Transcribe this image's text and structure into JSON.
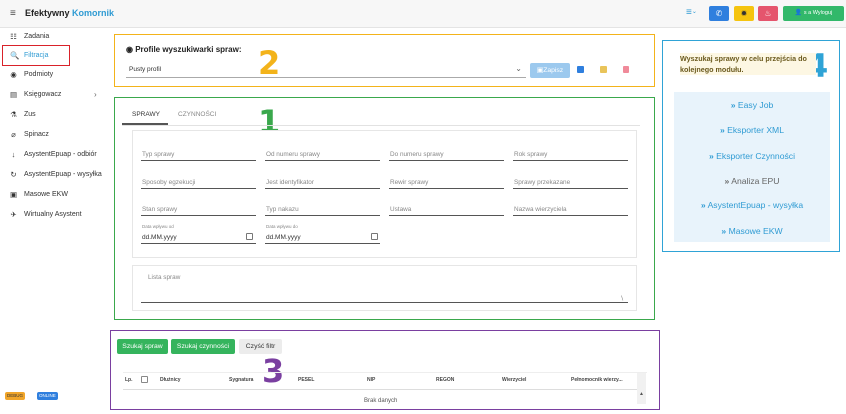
{
  "app": {
    "brand_primary": "Efektywny",
    "brand_secondary": "Komornik",
    "hamburger": "≡"
  },
  "toolbar": {
    "list_icon": "≡",
    "list_chevron": "⌄",
    "phone_icon": "✆",
    "gear_icon": "✹",
    "fire_icon": "♨",
    "user_icon": "👤",
    "user_label": "s a",
    "logout_label": "Wyloguj",
    "colors": {
      "list": "#2f9bd3",
      "phone": "#2f7fde",
      "gear": "#f5c40f",
      "fire": "#e5556d",
      "user": "#32b86a"
    }
  },
  "sidebar": {
    "items": [
      {
        "label": "Zadania",
        "icon": "☷",
        "icon_name": "tasks-list-icon"
      },
      {
        "label": "Filtracja",
        "icon": "🔍",
        "icon_name": "search-icon"
      },
      {
        "label": "Podmioty",
        "icon": "◉",
        "icon_name": "globe-icon"
      },
      {
        "label": "Księgowacz",
        "icon": "▤",
        "icon_name": "accounting-icon",
        "chevron": "›"
      },
      {
        "label": "Zus",
        "icon": "⚗",
        "icon_name": "zus-icon"
      },
      {
        "label": "Spinacz",
        "icon": "⌀",
        "icon_name": "paperclip-icon"
      },
      {
        "label": "AsystentEpuap - odbiór",
        "icon": "↓",
        "icon_name": "download-icon"
      },
      {
        "label": "AsystentEpuap - wysyłka",
        "icon": "↻",
        "icon_name": "send-icon"
      },
      {
        "label": "Masowe EKW",
        "icon": "▣",
        "icon_name": "database-icon"
      },
      {
        "label": "Wirtualny Asystent",
        "icon": "✈",
        "icon_name": "rocket-icon"
      }
    ]
  },
  "badges": {
    "debug": "DEBUG",
    "online": "ONLINE"
  },
  "annotations": {
    "n1": "1",
    "n2": "2",
    "n3": "3",
    "n4": "4"
  },
  "profiles": {
    "title": "Profile wyszukiwarki spraw:",
    "select_value": "Pusty profil",
    "save_label": "Zapisz"
  },
  "tabs": {
    "sprawy": "SPRAWY",
    "czynnosci": "CZYNNOŚCI"
  },
  "filters": {
    "typ_sprawy": "Typ sprawy",
    "od_numeru": "Od numeru sprawy",
    "do_numeru": "Do numeru sprawy",
    "rok": "Rok sprawy",
    "sposoby": "Sposoby egzekucji",
    "jest_id": "Jest identyfikator",
    "rewir": "Rewir sprawy",
    "przekazane": "Sprawy przekazane",
    "stan": "Stan sprawy",
    "typ_nakazu": "Typ nakazu",
    "ustawa": "Ustawa",
    "nazwa_wierzyciela": "Nazwa wierzyciela",
    "data_od_label": "Data wpływu od",
    "data_od_value": "dd.MM.yyyy",
    "data_do_label": "Data wpływu do",
    "data_do_value": "dd.MM.yyyy",
    "lista_spraw": "Lista spraw"
  },
  "right_panel": {
    "heading": "Wyszukaj sprawy w celu przejścia do kolejnego modułu.",
    "links": [
      "Easy Job",
      "Eksporter XML",
      "Eksporter Czynności",
      "Analiza EPU",
      "AsystentEpuap - wysyłka",
      "Masowe EKW"
    ],
    "arrow": "»"
  },
  "actions": {
    "szukaj_spraw": "Szukaj spraw",
    "szukaj_czynnosci": "Szukaj czynności",
    "czysc": "Czyść filtr"
  },
  "table": {
    "columns": [
      "Lp.",
      "Dłużnicy",
      "Sygnatura",
      "PESEL",
      "NIP",
      "REGON",
      "Wierzyciel",
      "Pełnomocnik wierzy..."
    ],
    "empty_text": "Brak danych"
  }
}
